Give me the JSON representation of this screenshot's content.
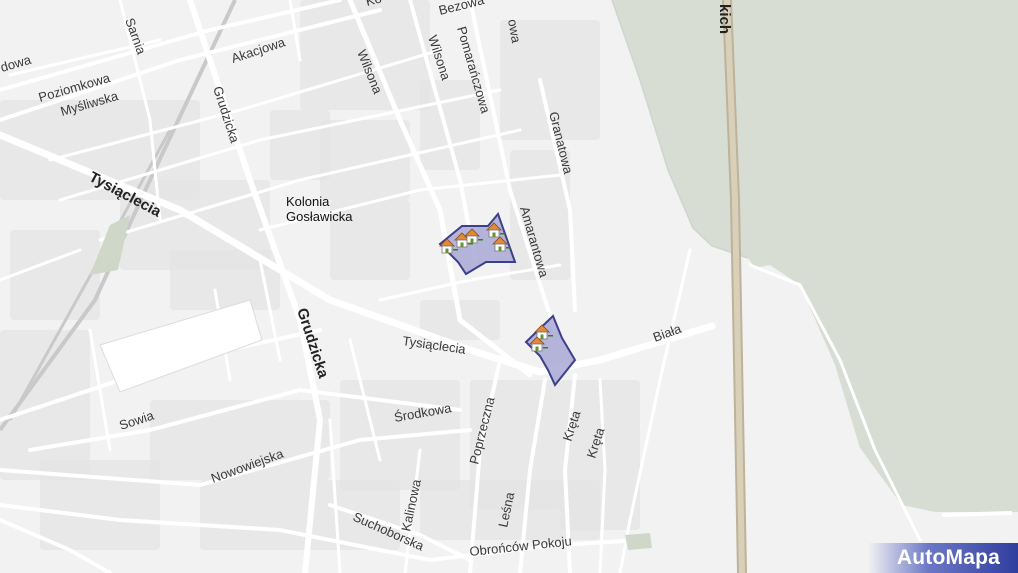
{
  "map": {
    "area_label": [
      "Kolonia",
      "Gosławicka"
    ],
    "streets": [
      {
        "key": "tysiaclecia_major",
        "name": "Tysiąclecia"
      },
      {
        "key": "tysiaclecia",
        "name": "Tysiąclecia"
      },
      {
        "key": "grudzicka_major",
        "name": "Grudzicka"
      },
      {
        "key": "grudzicka",
        "name": "Grudzicka"
      },
      {
        "key": "wilsona1",
        "name": "Wilsona"
      },
      {
        "key": "wilsona2",
        "name": "Wilsona"
      },
      {
        "key": "pomaranczowa",
        "name": "Pomarańczowa"
      },
      {
        "key": "bezowa",
        "name": "Bezowa"
      },
      {
        "key": "granatowa",
        "name": "Granatowa"
      },
      {
        "key": "amarantowa",
        "name": "Amarantowa"
      },
      {
        "key": "biala",
        "name": "Biała"
      },
      {
        "key": "sarnia",
        "name": "Sarnia"
      },
      {
        "key": "poziomkowa",
        "name": "Poziomkowa"
      },
      {
        "key": "mysliwska",
        "name": "Myśliwska"
      },
      {
        "key": "akacjowa",
        "name": "Akacjowa"
      },
      {
        "key": "sowia",
        "name": "Sowia"
      },
      {
        "key": "srodkowa",
        "name": "Środkowa"
      },
      {
        "key": "nowowiejska",
        "name": "Nowowiejska"
      },
      {
        "key": "poprzeczna",
        "name": "Poprzeczna"
      },
      {
        "key": "kreta1",
        "name": "Kręta"
      },
      {
        "key": "kreta2",
        "name": "Kręta"
      },
      {
        "key": "kalinowa",
        "name": "Kalinowa"
      },
      {
        "key": "lesna",
        "name": "Leśna"
      },
      {
        "key": "suchoborska",
        "name": "Suchoborska"
      },
      {
        "key": "obroncow",
        "name": "Obrońców Pokoju"
      },
      {
        "key": "dowa",
        "name": "dowa"
      },
      {
        "key": "owa",
        "name": "owa"
      },
      {
        "key": "kich",
        "name": "kich"
      },
      {
        "key": "ko",
        "name": "Ko"
      }
    ],
    "markers": [
      {
        "name": "house-marker"
      },
      {
        "name": "house-marker"
      },
      {
        "name": "house-marker"
      },
      {
        "name": "house-marker"
      },
      {
        "name": "house-marker"
      },
      {
        "name": "house-marker"
      },
      {
        "name": "house-marker"
      }
    ],
    "colors": {
      "background": "#f2f2f2",
      "road": "#ffffff",
      "building": "#e4e4e4",
      "water": "#d7ddd3",
      "highlight_fill": "#a9a9d6",
      "highlight_stroke": "#3c3f8a",
      "railway": "#c9c9c9",
      "highway": "#c8bfa8"
    }
  },
  "logo": {
    "text": "AutoMapa"
  }
}
